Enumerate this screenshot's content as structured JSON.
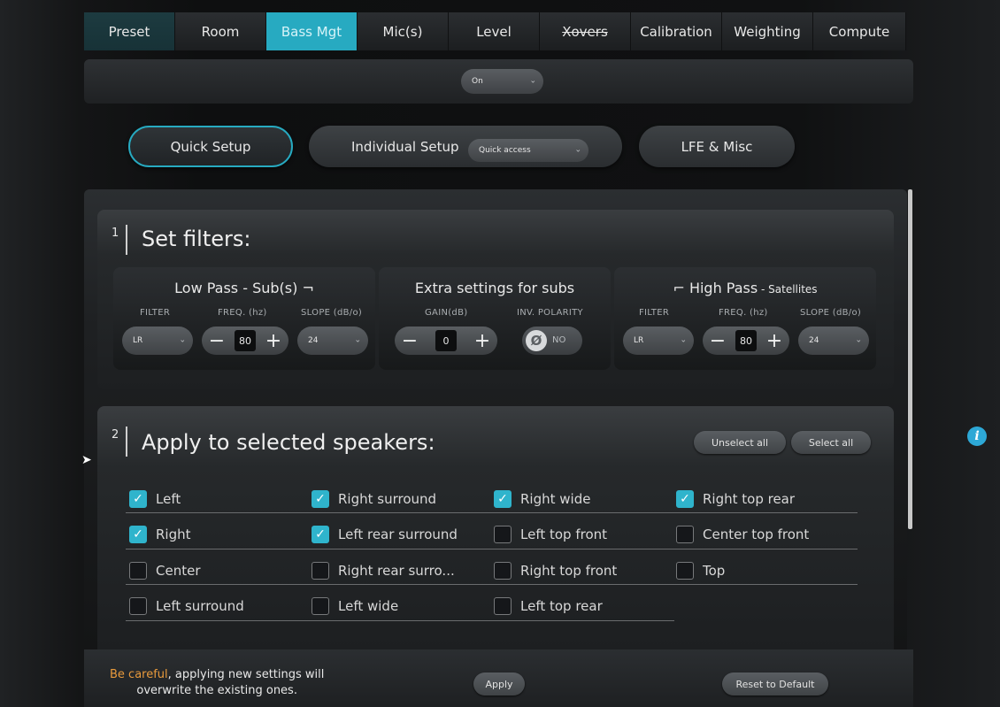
{
  "tabs": [
    "Preset",
    "Room",
    "Bass Mgt",
    "Mic(s)",
    "Level",
    "Xovers",
    "Calibration",
    "Weighting",
    "Compute"
  ],
  "mode": {
    "value": "On"
  },
  "modes": {
    "quick": "Quick Setup",
    "individual": "Individual Setup",
    "quick_access": "Quick access",
    "lfe": "LFE & Misc"
  },
  "section1": {
    "num": "1",
    "title": "Set filters:",
    "low_pass": {
      "title": "Low Pass - Sub(s)",
      "filter_label": "FILTER",
      "freq_label": "FREQ. (hz)",
      "slope_label": "SLOPE (dB/o)",
      "filter": "LR",
      "freq": "80",
      "slope": "24"
    },
    "extra": {
      "title": "Extra settings for subs",
      "gain_label": "GAIN(dB)",
      "pol_label": "INV. POLARITY",
      "gain": "0",
      "pol_symbol": "Ø",
      "pol_value": "NO"
    },
    "high_pass": {
      "title": "High Pass",
      "title_suffix": " - Satellites",
      "filter_label": "FILTER",
      "freq_label": "FREQ. (hz)",
      "slope_label": "SLOPE (dB/o)",
      "filter": "LR",
      "freq": "80",
      "slope": "24"
    }
  },
  "section2": {
    "num": "2",
    "title": "Apply to selected speakers:",
    "unselect_all": "Unselect all",
    "select_all": "Select all",
    "speakers": [
      {
        "label": "Left",
        "checked": true
      },
      {
        "label": "Right surround",
        "checked": true
      },
      {
        "label": "Right wide",
        "checked": true
      },
      {
        "label": "Right top rear",
        "checked": true
      },
      {
        "label": "Right",
        "checked": true
      },
      {
        "label": "Left rear surround",
        "checked": true
      },
      {
        "label": "Left top front",
        "checked": false
      },
      {
        "label": "Center top front",
        "checked": false
      },
      {
        "label": "Center",
        "checked": false
      },
      {
        "label": "Right rear surro...",
        "checked": false
      },
      {
        "label": "Right top front",
        "checked": false
      },
      {
        "label": "Top",
        "checked": false
      },
      {
        "label": "Left surround",
        "checked": false
      },
      {
        "label": "Left wide",
        "checked": false
      },
      {
        "label": "Left top rear",
        "checked": false
      }
    ]
  },
  "footer": {
    "warn_highlight": "Be careful",
    "warn_line1": ", applying new settings will",
    "warn_line2": "overwrite the existing ones.",
    "apply": "Apply",
    "reset": "Reset to Default"
  },
  "colors": {
    "accent": "#27aac1",
    "warning": "#e89a3c",
    "info": "#2da8d6"
  }
}
